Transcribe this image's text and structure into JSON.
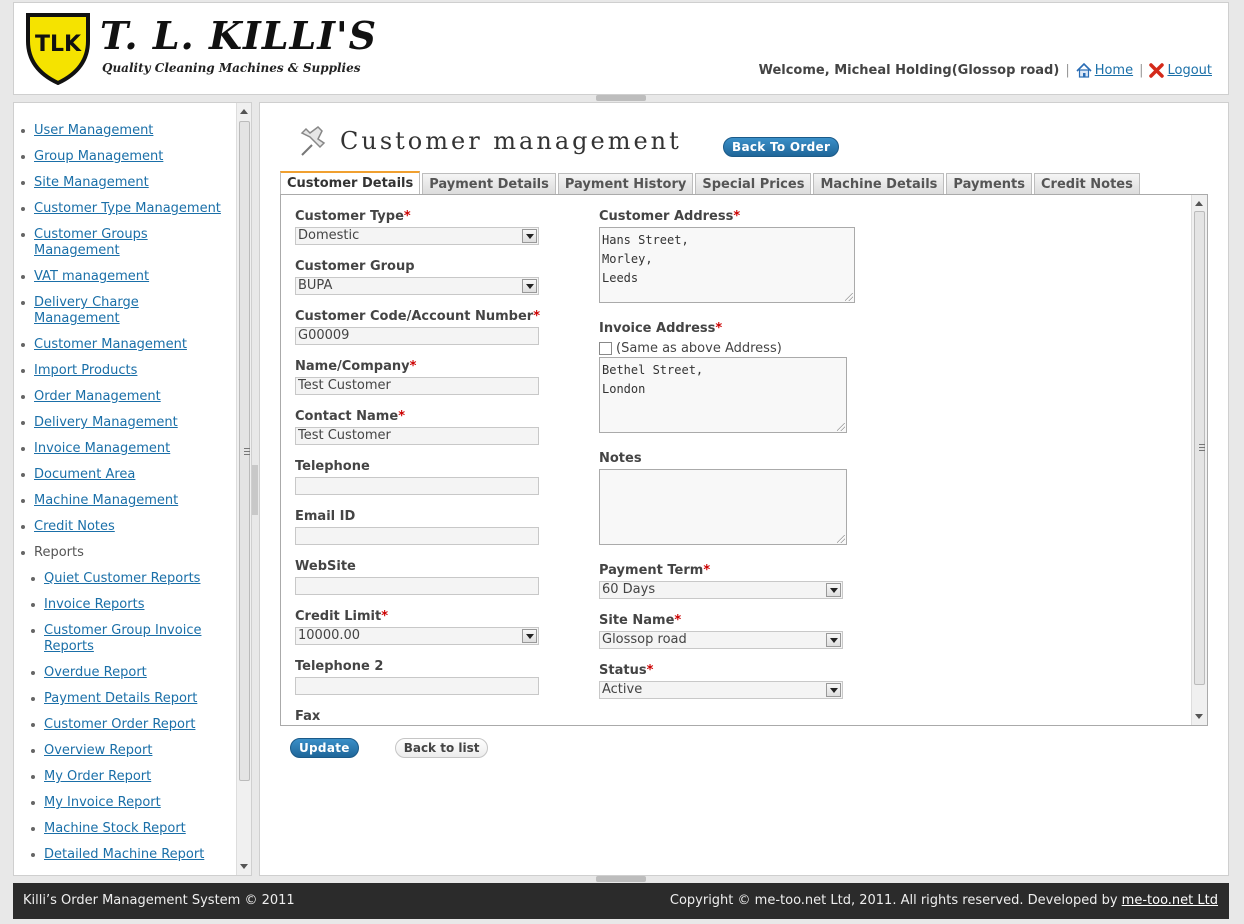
{
  "header": {
    "brand_title": "T. L. KILLI'S",
    "brand_tagline": "Quality Cleaning Machines & Supplies",
    "logo_initials": "TLK",
    "welcome": "Welcome, Micheal Holding(Glossop road)",
    "home_label": "Home",
    "logout_label": "Logout"
  },
  "sidebar": {
    "items": [
      {
        "label": "User Management"
      },
      {
        "label": "Group Management"
      },
      {
        "label": "Site Management"
      },
      {
        "label": "Customer Type Management"
      },
      {
        "label": "Customer Groups Management"
      },
      {
        "label": "VAT management"
      },
      {
        "label": "Delivery Charge Management"
      },
      {
        "label": "Customer Management"
      },
      {
        "label": "Import Products"
      },
      {
        "label": "Order Management"
      },
      {
        "label": "Delivery Management"
      },
      {
        "label": "Invoice Management"
      },
      {
        "label": "Document Area"
      },
      {
        "label": "Machine Management"
      },
      {
        "label": "Credit Notes"
      },
      {
        "label": "Reports"
      }
    ],
    "reports": [
      {
        "label": "Quiet Customer Reports"
      },
      {
        "label": "Invoice Reports"
      },
      {
        "label": "Customer Group Invoice Reports"
      },
      {
        "label": "Overdue Report"
      },
      {
        "label": "Payment Details Report"
      },
      {
        "label": "Customer Order Report"
      },
      {
        "label": "Overview Report"
      },
      {
        "label": "My Order Report"
      },
      {
        "label": "My Invoice Report"
      },
      {
        "label": "Machine Stock Report"
      },
      {
        "label": "Detailed Machine Report"
      }
    ]
  },
  "main": {
    "title": "Customer management",
    "back_to_order": "Back To Order",
    "tabs": [
      {
        "label": "Customer Details"
      },
      {
        "label": "Payment Details"
      },
      {
        "label": "Payment History"
      },
      {
        "label": "Special Prices"
      },
      {
        "label": "Machine Details"
      },
      {
        "label": "Payments"
      },
      {
        "label": "Credit Notes"
      }
    ],
    "form": {
      "customer_type": {
        "label": "Customer Type",
        "value": "Domestic"
      },
      "customer_group": {
        "label": "Customer Group",
        "value": "BUPA"
      },
      "customer_code": {
        "label": "Customer Code/Account Number",
        "value": "G00009"
      },
      "name_company": {
        "label": "Name/Company",
        "value": "Test Customer"
      },
      "contact_name": {
        "label": "Contact Name",
        "value": "Test Customer"
      },
      "telephone": {
        "label": "Telephone",
        "value": ""
      },
      "email": {
        "label": "Email ID",
        "value": ""
      },
      "website": {
        "label": "WebSite",
        "value": ""
      },
      "credit_limit": {
        "label": "Credit Limit",
        "value": "10000.00"
      },
      "telephone2": {
        "label": "Telephone 2",
        "value": ""
      },
      "fax": {
        "label": "Fax",
        "value": ""
      },
      "customer_address": {
        "label": "Customer Address",
        "value": "Hans Street,\nMorley,\nLeeds"
      },
      "invoice_address": {
        "label": "Invoice Address",
        "same_label": "(Same as above Address)",
        "value": "Bethel Street,\nLondon"
      },
      "notes": {
        "label": "Notes",
        "value": ""
      },
      "payment_term": {
        "label": "Payment Term",
        "value": "60 Days"
      },
      "site_name": {
        "label": "Site Name",
        "value": "Glossop road"
      },
      "status": {
        "label": "Status",
        "value": "Active"
      },
      "required_mark": "*"
    },
    "update_label": "Update",
    "back_to_list": "Back to list"
  },
  "footer": {
    "left": "Killi’s Order Management System © 2011",
    "right_prefix": "Copyright © me-too.net Ltd, 2011. All rights reserved. Developed by",
    "right_link": "me-too.net Ltd"
  },
  "colors": {
    "accent_blue": "#1f6699",
    "required": "#cc0000",
    "footer_bg": "#2b2b2b",
    "tab_active_top": "#f0a030",
    "logo_yellow": "#f5e300"
  }
}
